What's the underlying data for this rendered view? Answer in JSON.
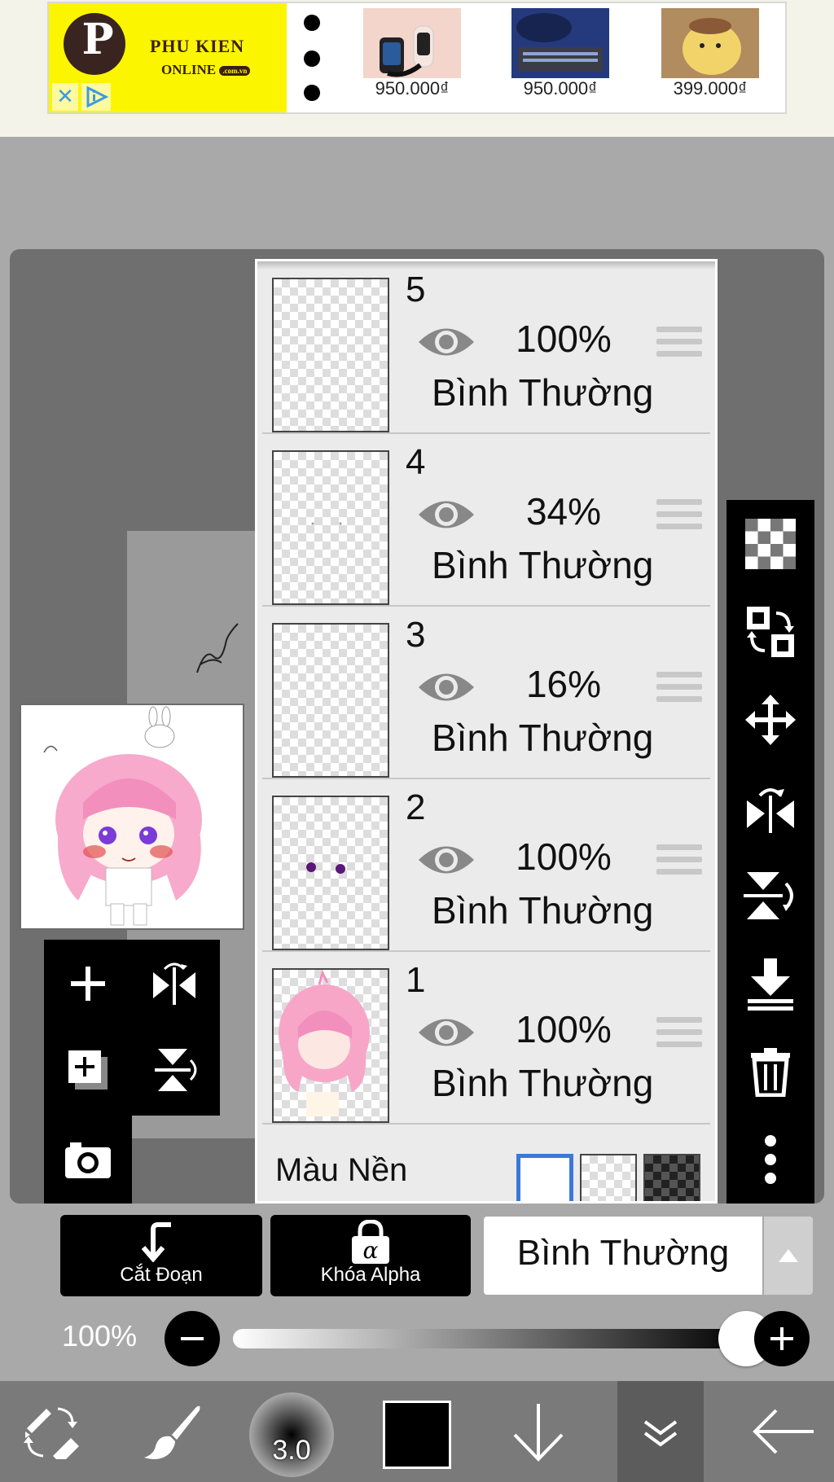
{
  "ad": {
    "brand_line1": "PHU KIEN",
    "brand_line2": "ONLINE",
    "brand_badge": ".com.vn",
    "close_glyph": "✕",
    "products": [
      {
        "price": "950.000₫",
        "icon": "smartwatch-image"
      },
      {
        "price": "950.000₫",
        "icon": "audio-device-image"
      },
      {
        "price": "399.000₫",
        "icon": "hand-warmer-image"
      }
    ]
  },
  "layers": [
    {
      "number": "5",
      "opacity": "100%",
      "blend": "Bình Thường"
    },
    {
      "number": "4",
      "opacity": "34%",
      "blend": "Bình Thường"
    },
    {
      "number": "3",
      "opacity": "16%",
      "blend": "Bình Thường"
    },
    {
      "number": "2",
      "opacity": "100%",
      "blend": "Bình Thường"
    },
    {
      "number": "1",
      "opacity": "100%",
      "blend": "Bình Thường"
    }
  ],
  "background_row": {
    "label": "Màu Nền",
    "selected": "white"
  },
  "controls": {
    "clip_label": "Cắt Đoạn",
    "alpha_label": "Khóa Alpha",
    "blend_mode": "Bình Thường",
    "opacity_label": "100%",
    "opacity_value": 1.0
  },
  "bottom_bar": {
    "brush_size": "3.0",
    "color": "#000000"
  },
  "colors": {
    "workspace": "#6f6f6f",
    "panel": "#ebebeb",
    "toolbar": "#000000",
    "ad_yellow": "#fbf600"
  }
}
